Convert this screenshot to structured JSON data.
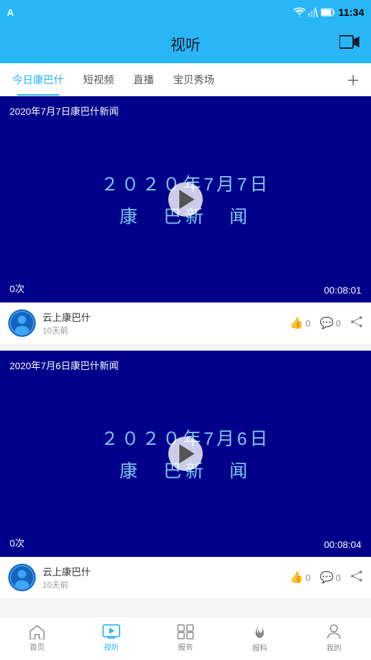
{
  "statusBar": {
    "leftIcon": "A",
    "time": "11:34"
  },
  "header": {
    "title": "视听",
    "cameraIconLabel": "video-camera-icon"
  },
  "tabs": [
    {
      "id": "today",
      "label": "今日康巴什",
      "active": true
    },
    {
      "id": "short",
      "label": "短视频",
      "active": false
    },
    {
      "id": "live",
      "label": "直播",
      "active": false
    },
    {
      "id": "baby",
      "label": "宝贝秀场",
      "active": false
    }
  ],
  "videos": [
    {
      "id": "v1",
      "titleOverlay": "2020年7月7日康巴什新闻",
      "centerDate": "2０２０年7月7日",
      "centerName": "康巴什新闻",
      "views": "0次",
      "duration": "00:08:01",
      "author": "云上康巴什",
      "timeAgo": "10天前",
      "likes": "0",
      "comments": "0"
    },
    {
      "id": "v2",
      "titleOverlay": "2020年7月6日康巴什新闻",
      "centerDate": "2０２０年7月6日",
      "centerName": "康巴什新闻",
      "views": "0次",
      "duration": "00:08:04",
      "author": "云上康巴什",
      "timeAgo": "10天前",
      "likes": "0",
      "comments": "0"
    }
  ],
  "bottomNav": [
    {
      "id": "home",
      "label": "首页",
      "icon": "home",
      "active": false
    },
    {
      "id": "media",
      "label": "视听",
      "icon": "tv",
      "active": true
    },
    {
      "id": "service",
      "label": "服务",
      "icon": "grid",
      "active": false
    },
    {
      "id": "report",
      "label": "报料",
      "icon": "fire",
      "active": false
    },
    {
      "id": "mine",
      "label": "我的",
      "icon": "person",
      "active": false
    }
  ]
}
